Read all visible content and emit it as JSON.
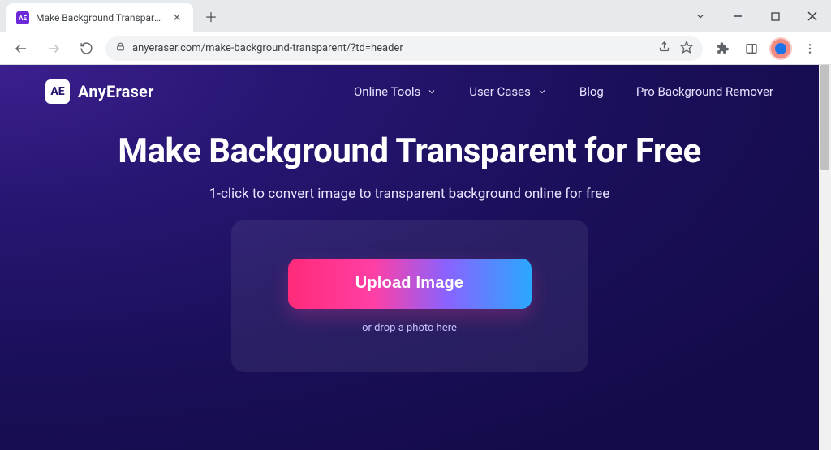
{
  "browser": {
    "tab": {
      "favicon_text": "AE",
      "title": "Make Background Transparent in"
    },
    "url": "anyeraser.com/make-background-transparent/?td=header"
  },
  "site": {
    "brand": {
      "logo_text": "AE",
      "name": "AnyEraser"
    },
    "nav": [
      {
        "label": "Online Tools",
        "has_submenu": true
      },
      {
        "label": "User Cases",
        "has_submenu": true
      },
      {
        "label": "Blog",
        "has_submenu": false
      },
      {
        "label": "Pro Background Remover",
        "has_submenu": false
      }
    ]
  },
  "hero": {
    "title": "Make Background Transparent for Free",
    "subtitle": "1-click to convert image to transparent background online for free",
    "upload_button": "Upload Image",
    "drop_hint": "or drop a photo here"
  },
  "colors": {
    "page_bg_start": "#3b1f8e",
    "page_bg_end": "#140b4a",
    "upload_grad_start": "#ff2a7a",
    "upload_grad_end": "#2aa8ff"
  }
}
